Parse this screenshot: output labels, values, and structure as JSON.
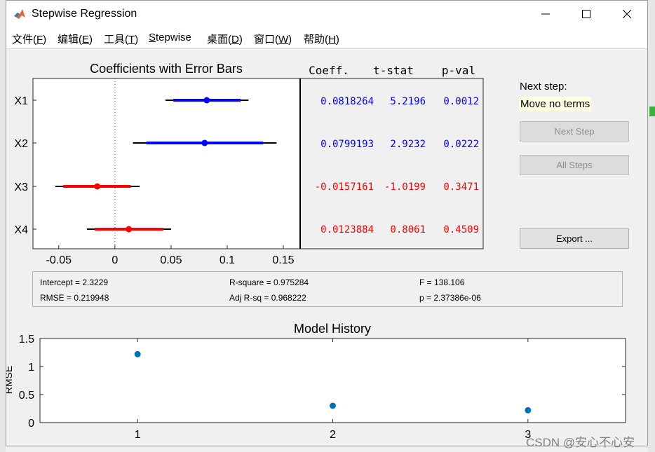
{
  "window": {
    "title": "Stepwise Regression"
  },
  "menu": [
    {
      "label": "文件(",
      "key": "F",
      "tail": ")"
    },
    {
      "label": "编辑(",
      "key": "E",
      "tail": ")"
    },
    {
      "label": "工具(",
      "key": "T",
      "tail": ")"
    },
    {
      "label": "",
      "key": "S",
      "tail": "tepwise"
    },
    {
      "label": "桌面(",
      "key": "D",
      "tail": ")"
    },
    {
      "label": "窗口(",
      "key": "W",
      "tail": ")"
    },
    {
      "label": "帮助(",
      "key": "H",
      "tail": ")"
    }
  ],
  "coef_plot": {
    "title": "Coefficients with Error Bars",
    "xlim": [
      -0.073,
      0.165
    ],
    "xticks": [
      "-0.05",
      "0",
      "0.05",
      "0.1",
      "0.15"
    ],
    "xtick_values": [
      -0.05,
      0,
      0.05,
      0.1,
      0.15
    ],
    "rows": [
      {
        "name": "X1",
        "coef": 0.0818264,
        "inner": [
          0.052,
          0.112
        ],
        "outer": [
          0.045,
          0.119
        ],
        "in_model": true
      },
      {
        "name": "X2",
        "coef": 0.0799193,
        "inner": [
          0.028,
          0.132
        ],
        "outer": [
          0.016,
          0.144
        ],
        "in_model": true
      },
      {
        "name": "X3",
        "coef": -0.0157161,
        "inner": [
          -0.046,
          0.014
        ],
        "outer": [
          -0.053,
          0.022
        ],
        "in_model": false
      },
      {
        "name": "X4",
        "coef": 0.0123884,
        "inner": [
          -0.018,
          0.043
        ],
        "outer": [
          -0.025,
          0.05
        ],
        "in_model": false
      }
    ]
  },
  "coef_table": {
    "headers": [
      "Coeff.",
      "t-stat",
      "p-val"
    ],
    "rows": [
      {
        "coeff": "0.0818264",
        "tstat": "5.2196",
        "pval": "0.0012",
        "in_model": true
      },
      {
        "coeff": "0.0799193",
        "tstat": "2.9232",
        "pval": "0.0222",
        "in_model": true
      },
      {
        "coeff": "-0.0157161",
        "tstat": "-1.0199",
        "pval": "0.3471",
        "in_model": false
      },
      {
        "coeff": "0.0123884",
        "tstat": "0.8061",
        "pval": "0.4509",
        "in_model": false
      }
    ]
  },
  "next_step": {
    "label": "Next step:",
    "value": "Move no terms"
  },
  "buttons": {
    "next_step": "Next Step",
    "all_steps": "All Steps",
    "export": "Export ..."
  },
  "stats": {
    "intercept": "Intercept = 2.3229",
    "rsquare": "R-square = 0.975284",
    "f": "F = 138.106",
    "rmse": "RMSE = 0.219948",
    "adj_rsq": "Adj R-sq = 0.968222",
    "p": "p = 2.37386e-06"
  },
  "history_plot": {
    "title": "Model History",
    "ylabel": "RMSE",
    "ylim": [
      0,
      1.5
    ],
    "yticks": [
      "0",
      "0.5",
      "1",
      "1.5"
    ],
    "ytick_values": [
      0,
      0.5,
      1,
      1.5
    ],
    "xlim": [
      0.5,
      3.5
    ],
    "xticks": [
      "1",
      "2",
      "3"
    ],
    "xtick_values": [
      1,
      2,
      3
    ],
    "points": [
      {
        "x": 1,
        "y": 1.22
      },
      {
        "x": 2,
        "y": 0.3
      },
      {
        "x": 3,
        "y": 0.22
      }
    ]
  },
  "chart_data": [
    {
      "type": "scatter",
      "title": "Coefficients with Error Bars",
      "categories": [
        "X1",
        "X2",
        "X3",
        "X4"
      ],
      "values": [
        0.0818264,
        0.0799193,
        -0.0157161,
        0.0123884
      ],
      "xlim": [
        -0.073,
        0.165
      ]
    },
    {
      "type": "scatter",
      "title": "Model History",
      "ylabel": "RMSE",
      "x": [
        1,
        2,
        3
      ],
      "values": [
        1.22,
        0.3,
        0.22
      ],
      "ylim": [
        0,
        1.5
      ]
    }
  ],
  "watermark": "CSDN @安心不心安",
  "colors": {
    "in_model": "#0000ff",
    "out_model": "#ff0000",
    "history_point": "#0072bd",
    "next_step_bg": "#ffffe1"
  }
}
